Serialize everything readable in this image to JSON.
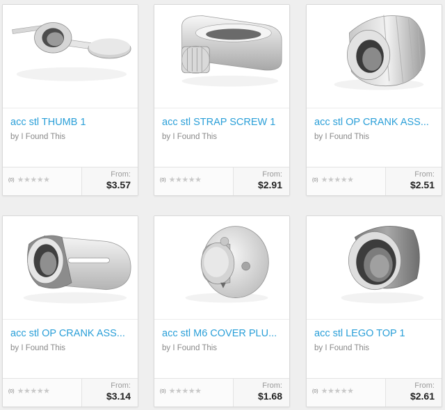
{
  "products": [
    {
      "title": "acc stl THUMB 1",
      "byline": "by I Found This",
      "rating_count": "(0)",
      "from_label": "From:",
      "price": "$3.57",
      "image": "thumb-lever-part-icon"
    },
    {
      "title": "acc stl STRAP SCREW 1",
      "byline": "by I Found This",
      "rating_count": "(0)",
      "from_label": "From:",
      "price": "$2.91",
      "image": "strap-screw-part-icon"
    },
    {
      "title": "acc stl OP CRANK ASS...",
      "byline": "by I Found This",
      "rating_count": "(0)",
      "from_label": "From:",
      "price": "$2.51",
      "image": "crank-knob-part-icon"
    },
    {
      "title": "acc stl OP CRANK ASS...",
      "byline": "by I Found This",
      "rating_count": "(0)",
      "from_label": "From:",
      "price": "$3.14",
      "image": "crank-arm-part-icon"
    },
    {
      "title": "acc stl M6 COVER PLU...",
      "byline": "by I Found This",
      "rating_count": "(0)",
      "from_label": "From:",
      "price": "$1.68",
      "image": "cover-plug-part-icon"
    },
    {
      "title": "acc stl LEGO TOP 1",
      "byline": "by I Found This",
      "rating_count": "(0)",
      "from_label": "From:",
      "price": "$2.61",
      "image": "lego-top-part-icon"
    }
  ],
  "star_glyph": "★",
  "colors": {
    "title": "#2a9fd8",
    "background": "#efefef",
    "star_empty": "#c9c9c9"
  }
}
